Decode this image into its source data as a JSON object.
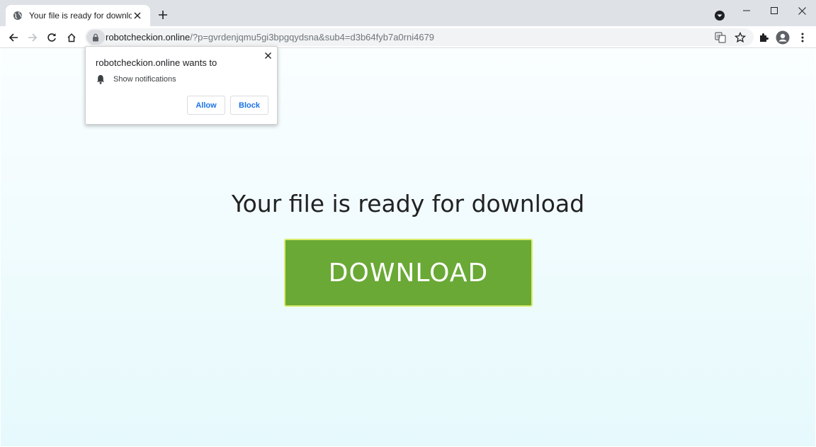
{
  "tab": {
    "title": "Your file is ready for download",
    "icon": "globe-icon"
  },
  "omnibox": {
    "host": "robotcheckion.online",
    "path": "/?p=gvrdenjqmu5gi3bpgqydsna&sub4=d3b64fyb7a0rni4679"
  },
  "popup": {
    "title": "robotcheckion.online wants to",
    "permission": "Show notifications",
    "allow_label": "Allow",
    "block_label": "Block"
  },
  "page": {
    "headline": "Your file is ready for download",
    "download_label": "DOWNLOAD"
  },
  "colors": {
    "button_green": "#6aa935",
    "button_border": "#d9ec6a",
    "link_blue": "#1a73e8"
  }
}
